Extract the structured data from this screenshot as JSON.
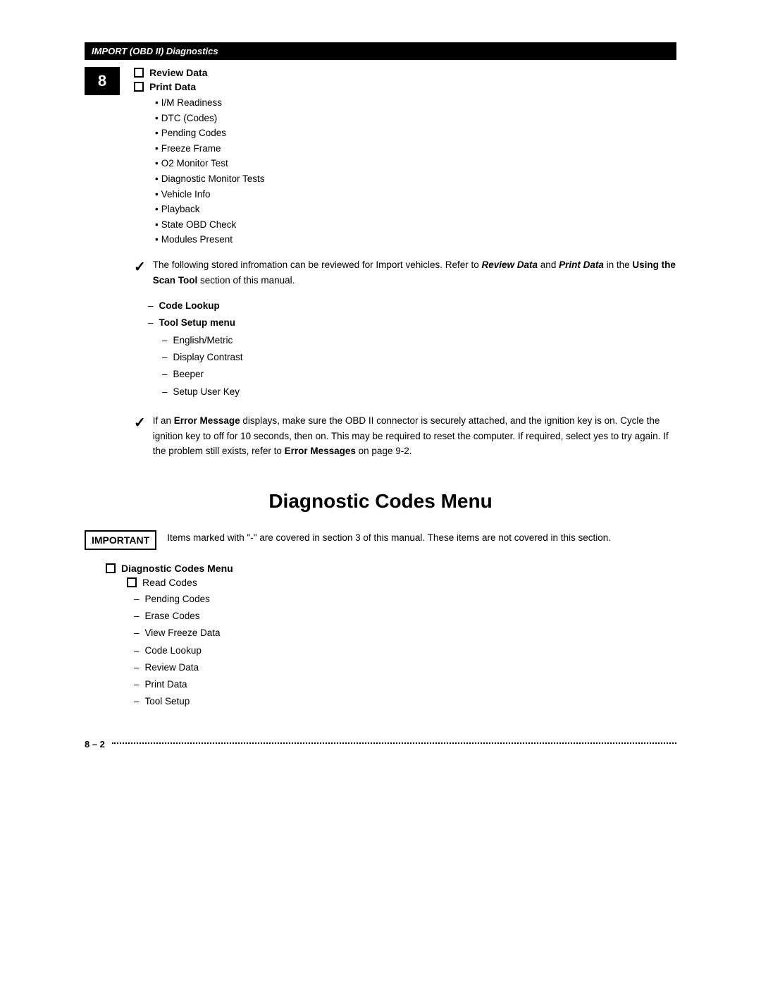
{
  "header": {
    "bar_text": "IMPORT (OBD II) Diagnostics"
  },
  "chapter": {
    "number": "8"
  },
  "top_section": {
    "review_data_label": "Review Data",
    "print_data_label": "Print Data",
    "print_data_subitems": [
      "I/M Readiness",
      "DTC (Codes)",
      "Pending Codes",
      "Freeze Frame",
      "O2 Monitor Test",
      "Diagnostic Monitor Tests",
      "Vehicle Info",
      "Playback",
      "State OBD Check",
      "Modules Present"
    ],
    "note1": {
      "text": "The following stored infromation can be reviewed for Import vehicles. Refer to ",
      "review_data": "Review Data",
      "and": " and ",
      "print_data": "Print Data",
      "in_the": " in the ",
      "using_scan_tool": "Using the Scan Tool",
      "rest": " section of this manual."
    }
  },
  "tool_setup_section": {
    "code_lookup_label": "Code Lookup",
    "tool_setup_label": "Tool Setup menu",
    "subitems": [
      "English/Metric",
      "Display Contrast",
      "Beeper",
      "Setup User Key"
    ]
  },
  "note2": {
    "prefix": "If an ",
    "error_message": "Error Message",
    "text": " displays, make sure the OBD  II connector is securely attached, and the ignition key is on. Cycle the ignition key to off for 10 seconds, then on. This may be required to reset the computer. If required, select yes to try again. If the problem still exists, refer to ",
    "error_messages": "Error Messages",
    "suffix": " on page 9-2."
  },
  "diagnostic_codes_title": "Diagnostic Codes Menu",
  "important_block": {
    "label": "IMPORTANT",
    "text": "Items marked with \"-\" are covered in section 3 of this manual. These items are not covered in this section."
  },
  "diagnostic_codes_menu": {
    "label": "Diagnostic Codes Menu",
    "subitems_checkbox": [
      "Read Codes"
    ],
    "subitems_dash": [
      "Pending Codes",
      "Erase Codes",
      "View Freeze Data",
      "Code Lookup",
      "Review Data",
      "Print Data",
      "Tool Setup"
    ]
  },
  "footer": {
    "page": "8 – 2"
  }
}
